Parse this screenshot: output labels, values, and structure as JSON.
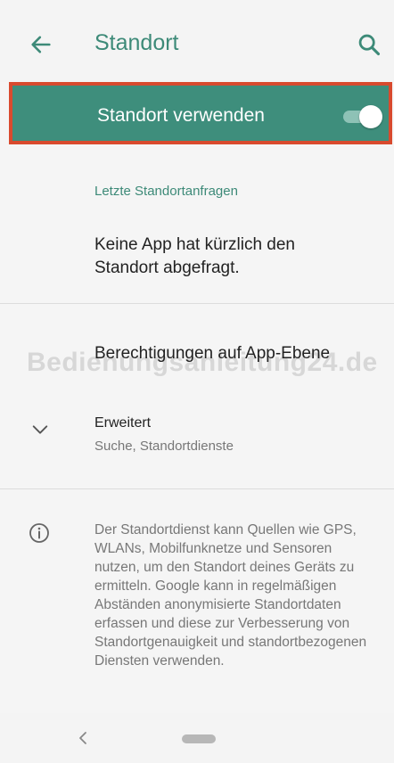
{
  "header": {
    "title": "Standort",
    "back_icon": "arrow-left-icon",
    "search_icon": "search-icon"
  },
  "main_switch": {
    "label": "Standort verwenden",
    "state": "on",
    "accent": "#3e8e7c",
    "highlight_border": "#d84a2e"
  },
  "recent_requests": {
    "header": "Letzte Standortanfragen",
    "text": "Keine App hat kürzlich den Standort abgefragt."
  },
  "permissions": {
    "label": "Berechtigungen auf App-Ebene"
  },
  "advanced": {
    "title": "Erweitert",
    "subtitle": "Suche, Standortdienste",
    "icon": "chevron-down-icon"
  },
  "info": {
    "icon": "info-icon",
    "text": "Der Standortdienst kann Quellen wie GPS, WLANs, Mobilfunknetze und Sensoren nutzen, um den Standort deines Geräts zu ermitteln. Google kann in regelmäßigen Abständen anonymisierte Standortdaten erfassen und diese zur Verbesserung von Standortgenauigkeit und standortbezogenen Diensten verwenden."
  },
  "watermark": "Bedienungsanleitung24.de",
  "navbar": {
    "back_icon": "nav-back-icon",
    "home_icon": "home-pill-icon"
  }
}
